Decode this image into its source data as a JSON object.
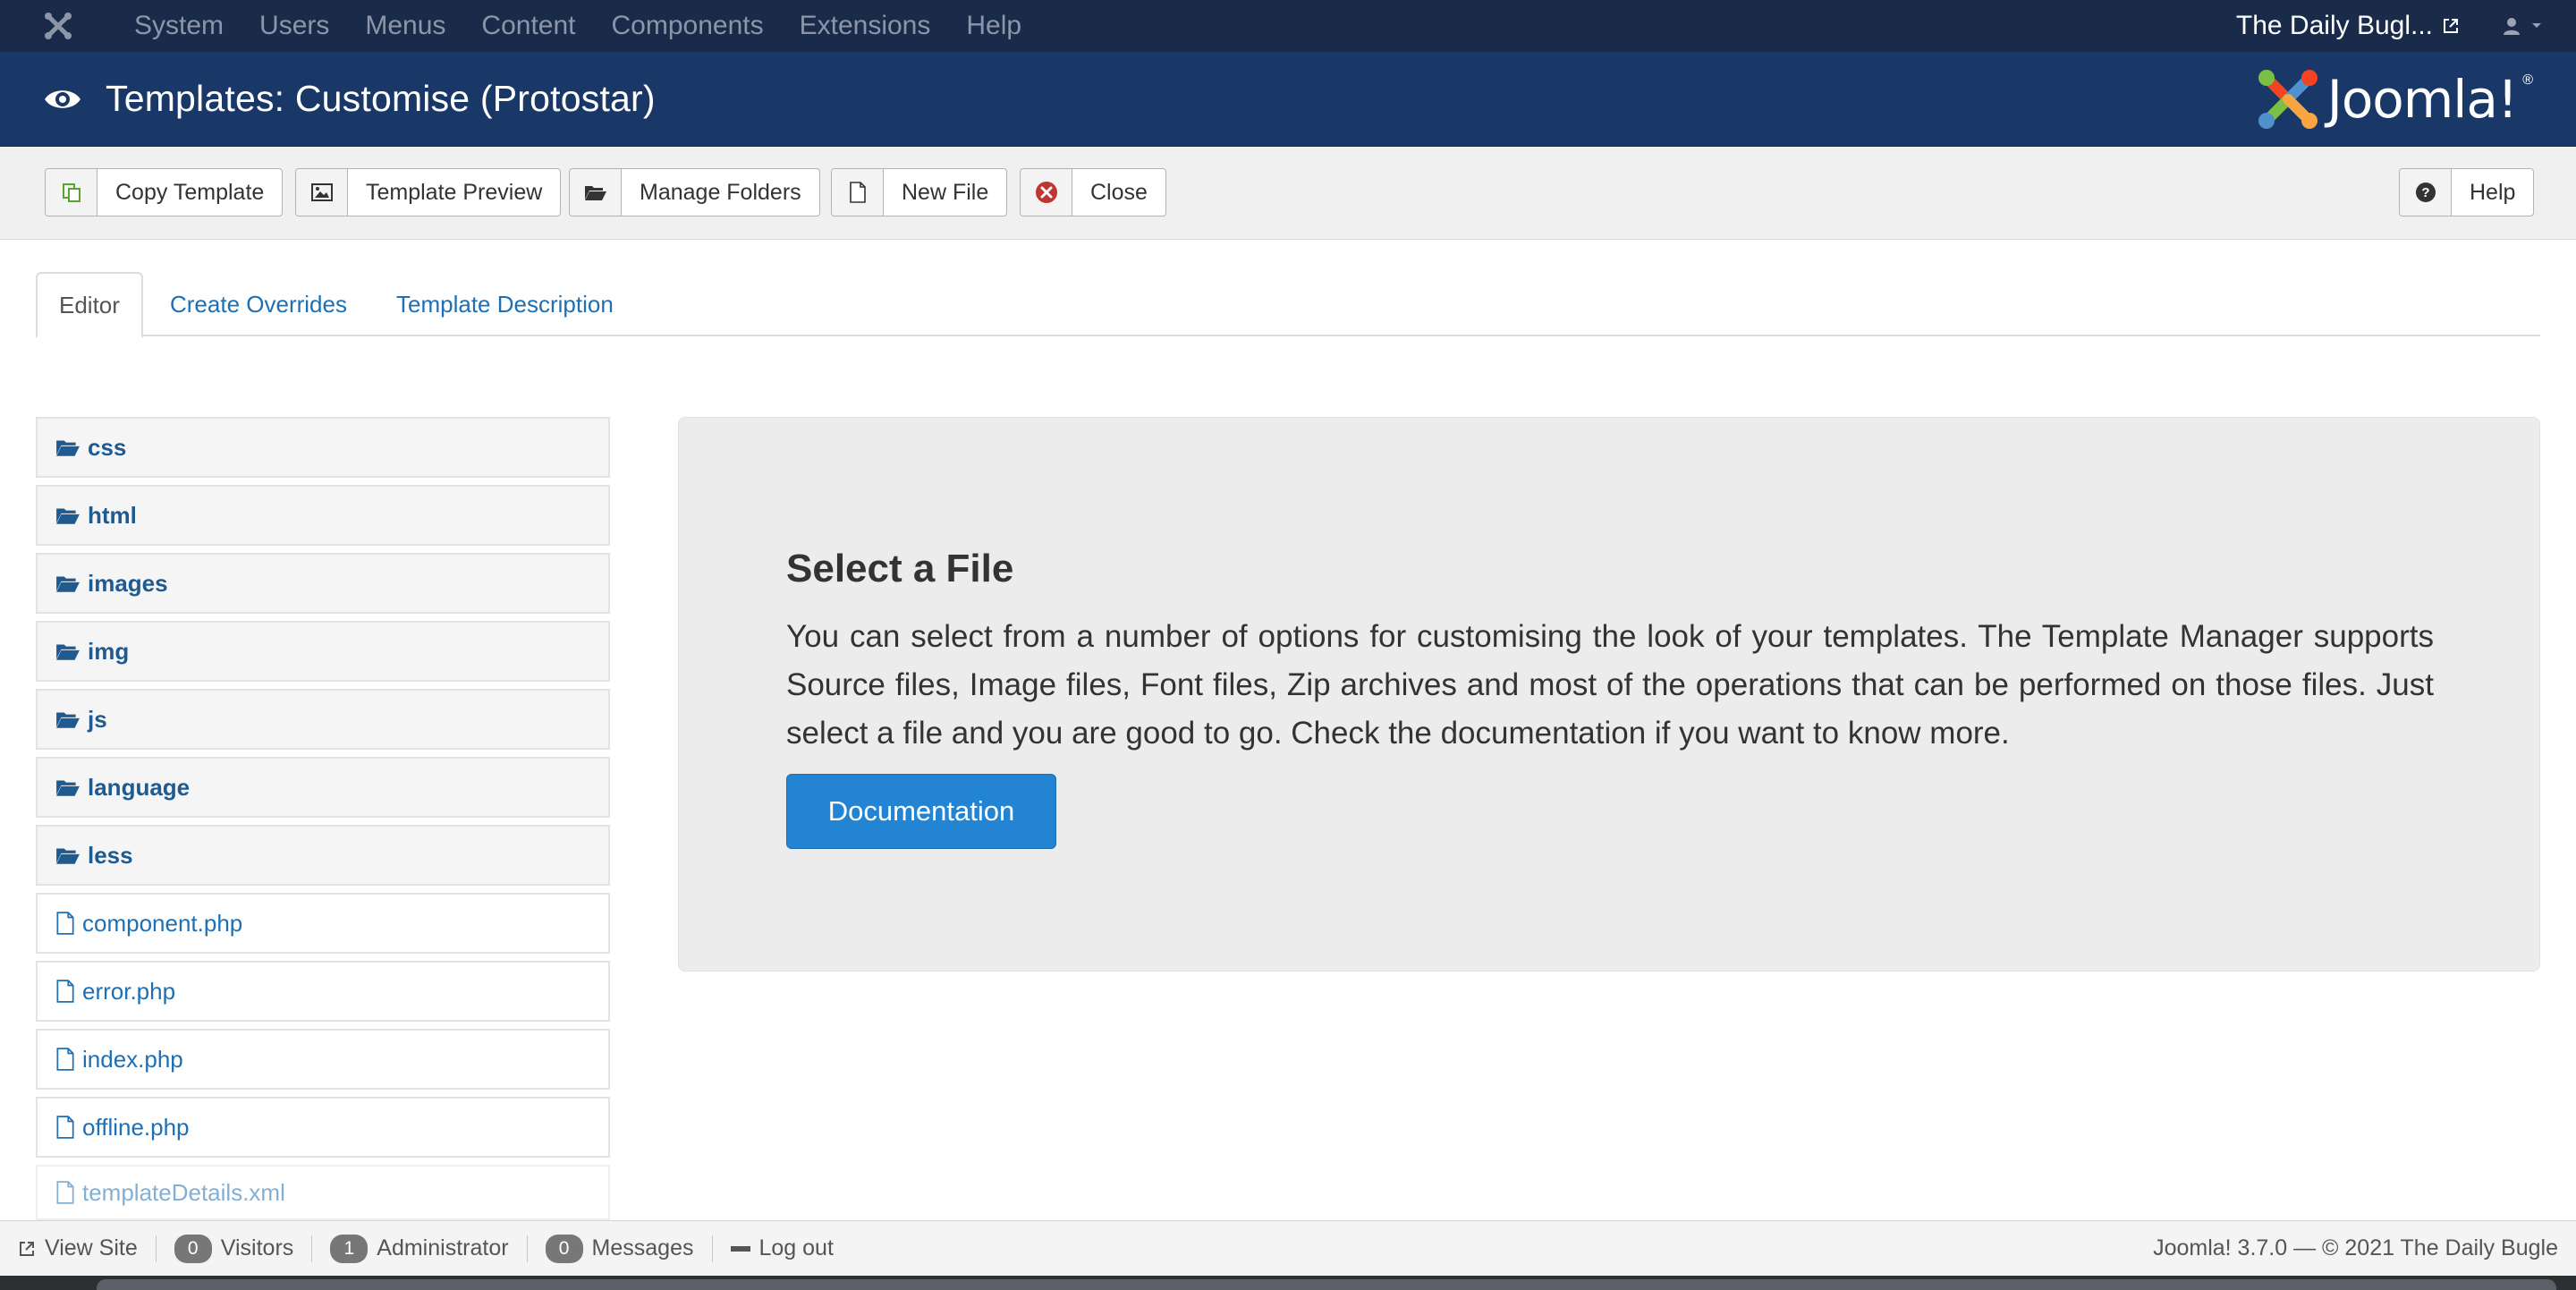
{
  "topbar": {
    "nav": [
      "System",
      "Users",
      "Menus",
      "Content",
      "Components",
      "Extensions",
      "Help"
    ],
    "site_name": "The Daily Bugl..."
  },
  "header": {
    "title": "Templates: Customise (Protostar)",
    "logo_text": "Joomla!",
    "logo_reg": "®"
  },
  "toolbar": {
    "copy_template": "Copy Template",
    "template_preview": "Template Preview",
    "manage_folders": "Manage Folders",
    "new_file": "New File",
    "close": "Close",
    "help": "Help"
  },
  "tabs": {
    "editor": "Editor",
    "create_overrides": "Create Overrides",
    "template_description": "Template Description"
  },
  "tree": {
    "folders": [
      "css",
      "html",
      "images",
      "img",
      "js",
      "language",
      "less"
    ],
    "files": [
      "component.php",
      "error.php",
      "index.php",
      "offline.php",
      "templateDetails.xml"
    ]
  },
  "panel": {
    "heading": "Select a File",
    "body": "You can select from a number of options for customising the look of your templates. The Template Manager supports Source files, Image files, Font files, Zip archives and most of the operations that can be performed on those files. Just select a file and you are good to go. Check the documentation if you want to know more.",
    "button": "Documentation"
  },
  "statusbar": {
    "view_site": "View Site",
    "visitors_count": "0",
    "visitors": "Visitors",
    "admin_count": "1",
    "admin": "Administrator",
    "messages_count": "0",
    "messages": "Messages",
    "logout": "Log out",
    "version": "Joomla! 3.7.0  —  © 2021 The Daily Bugle"
  },
  "colors": {
    "topbar": "#1a2b4a",
    "header": "#1a3867",
    "primary_button": "#2384d3",
    "link": "#1f6fb2"
  }
}
